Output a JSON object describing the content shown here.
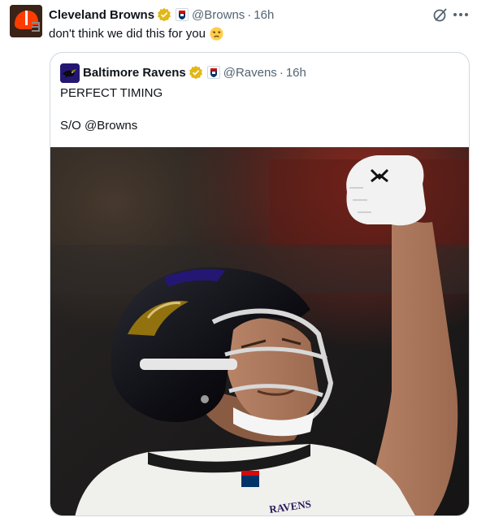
{
  "tweet": {
    "author_name": "Cleveland Browns",
    "handle": "@Browns",
    "separator": "·",
    "time": "16h",
    "text": "don't think we did this for you",
    "emoji": "unamused-face",
    "avatar_icon": "browns-helmet-logo",
    "icons": [
      "verified-badge",
      "nfl-affiliate-badge",
      "grok-icon",
      "more-icon"
    ]
  },
  "quoted": {
    "author_name": "Baltimore Ravens",
    "handle": "@Ravens",
    "separator": "·",
    "time": "16h",
    "line1": "PERFECT TIMING",
    "line2": "S/O @Browns",
    "avatar_icon": "ravens-logo",
    "photo": {
      "subject": "football player celebrating with raised fist",
      "jersey_text": "RAVENS"
    }
  },
  "colors": {
    "verified_gold": "#e2b719",
    "ravens_purple": "#241773",
    "browns_orange": "#ff3c00",
    "secondary_text": "#536471"
  }
}
